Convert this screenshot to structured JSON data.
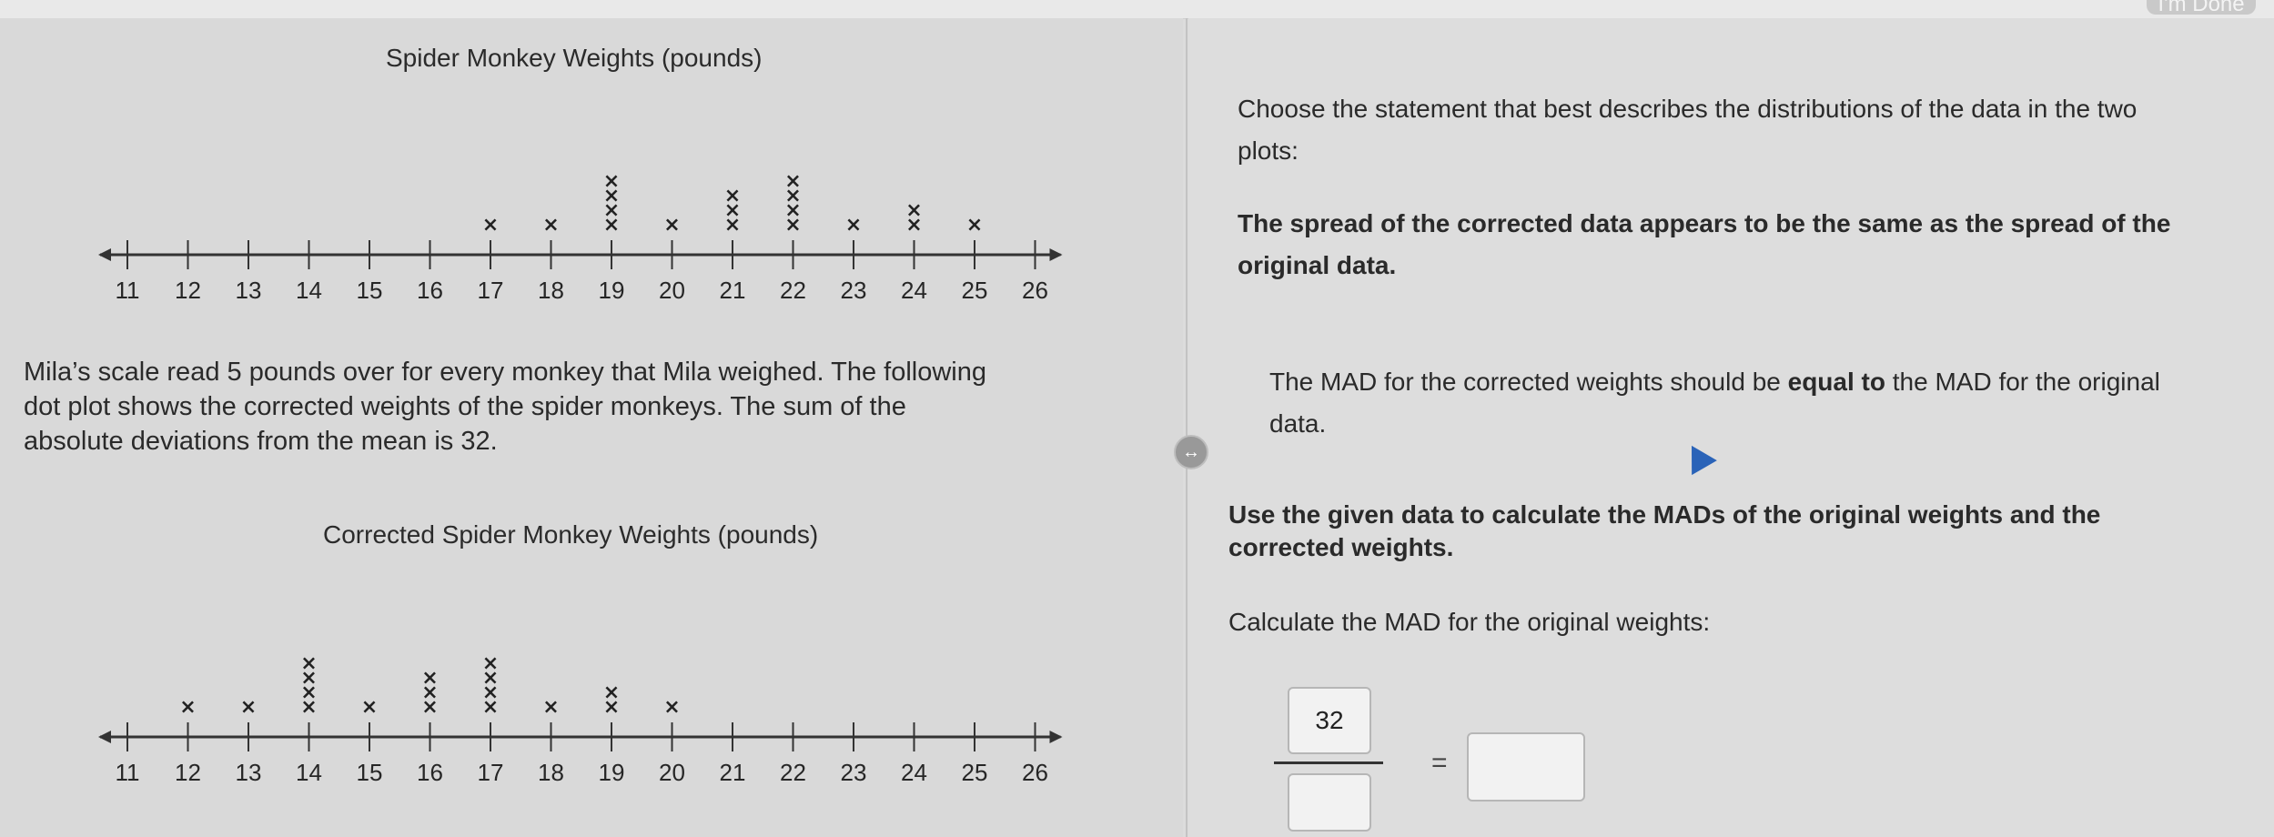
{
  "header": {
    "done_label": "I'm Done"
  },
  "plot1": {
    "title": "Spider Monkey Weights (pounds)",
    "chart_data": {
      "type": "dot",
      "title": "Spider Monkey Weights (pounds)",
      "axis_min": 11,
      "axis_max": 26,
      "ticks": [
        11,
        12,
        13,
        14,
        15,
        16,
        17,
        18,
        19,
        20,
        21,
        22,
        23,
        24,
        25,
        26
      ],
      "points": [
        {
          "x": 17,
          "count": 1
        },
        {
          "x": 18,
          "count": 1
        },
        {
          "x": 19,
          "count": 4
        },
        {
          "x": 20,
          "count": 1
        },
        {
          "x": 21,
          "count": 3
        },
        {
          "x": 22,
          "count": 4
        },
        {
          "x": 23,
          "count": 1
        },
        {
          "x": 24,
          "count": 2
        },
        {
          "x": 25,
          "count": 1
        }
      ]
    }
  },
  "problem": {
    "line1": "Mila’s scale read 5 pounds over for every monkey that Mila weighed. The following",
    "line2": "dot plot shows the corrected weights of the spider monkeys. The sum of the",
    "line3": "absolute deviations from the mean is 32."
  },
  "plot2": {
    "title": "Corrected Spider Monkey Weights (pounds)",
    "chart_data": {
      "type": "dot",
      "title": "Corrected Spider Monkey Weights (pounds)",
      "axis_min": 11,
      "axis_max": 26,
      "ticks": [
        11,
        12,
        13,
        14,
        15,
        16,
        17,
        18,
        19,
        20,
        21,
        22,
        23,
        24,
        25,
        26
      ],
      "points": [
        {
          "x": 12,
          "count": 1
        },
        {
          "x": 13,
          "count": 1
        },
        {
          "x": 14,
          "count": 4
        },
        {
          "x": 15,
          "count": 1
        },
        {
          "x": 16,
          "count": 3
        },
        {
          "x": 17,
          "count": 4
        },
        {
          "x": 18,
          "count": 1
        },
        {
          "x": 19,
          "count": 2
        },
        {
          "x": 20,
          "count": 1
        }
      ]
    }
  },
  "right": {
    "prompt_line1": "Choose the statement that best describes the distributions of the data in the two",
    "prompt_line2": "plots:",
    "answer_line1": "The spread of the corrected data appears to be the same as the spread of the",
    "answer_line2": "original data.",
    "mad_pre": "The MAD for the corrected weights should be ",
    "mad_bold": "equal to",
    "mad_post": " the MAD for the original",
    "mad_line2": "data.",
    "instr_line1": "Use the given data to calculate the MADs of the original weights and the",
    "instr_line2": "corrected weights.",
    "calc_label": "Calculate the MAD for the original weights:",
    "numerator": "32",
    "equals": "="
  },
  "icons": {
    "toggle": "swap-arrows-icon",
    "cursor": "pointer-arrow-icon"
  }
}
